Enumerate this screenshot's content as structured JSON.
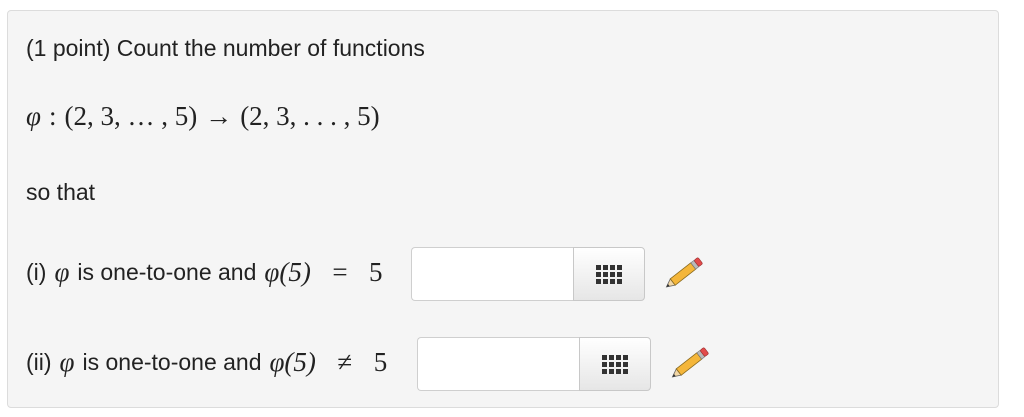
{
  "problem": {
    "intro": "(1 point) Count the number of functions",
    "mapping": {
      "symbol": "φ",
      "colon": ":",
      "domain": "(2, 3, … , 5)",
      "arrow": "→",
      "codomain": "(2, 3, . . . , 5)"
    },
    "so_that": "so that",
    "parts": [
      {
        "label": "(i)",
        "symbol": "φ",
        "text": "is one-to-one and",
        "condition_func": "φ(5)",
        "relation": "=",
        "value": "5",
        "answer_value": "",
        "answer_placeholder": ""
      },
      {
        "label": "(ii)",
        "symbol": "φ",
        "text": "is one-to-one and",
        "condition_func": "φ(5)",
        "relation": "≠",
        "value": "5",
        "answer_value": "",
        "answer_placeholder": ""
      }
    ]
  },
  "icons": {
    "palette": "grid-icon",
    "edit": "pencil-icon",
    "pencil_body_color": "#f4b63a",
    "pencil_eraser_color": "#e24b4b",
    "pencil_ferrule_color": "#b9b9b9"
  }
}
